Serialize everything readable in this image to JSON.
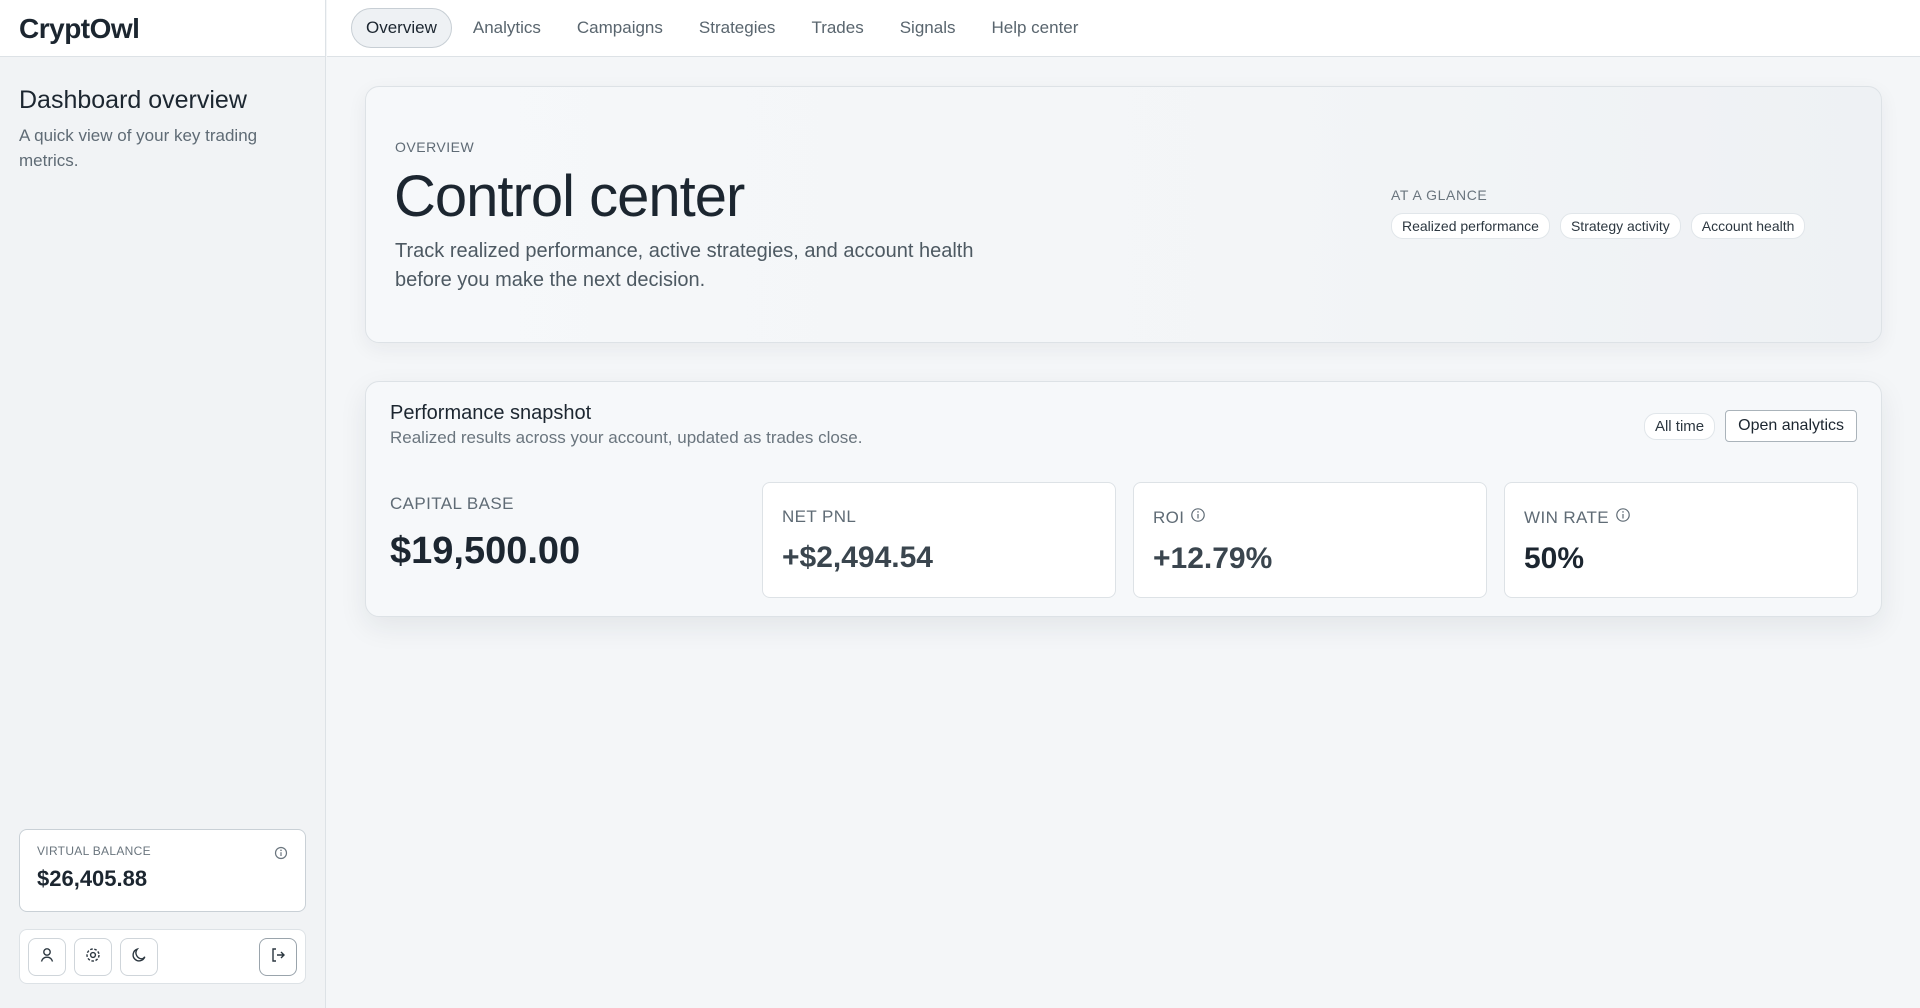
{
  "app": {
    "brand": "CryptOwl"
  },
  "sidebar": {
    "title": "Dashboard overview",
    "subtitle": "A quick view of your key trading metrics.",
    "balance": {
      "label": "VIRTUAL BALANCE",
      "value": "$26,405.88"
    },
    "icons": [
      "user-icon",
      "gear-icon",
      "moon-icon",
      "logout-icon"
    ]
  },
  "nav": {
    "tabs": [
      {
        "label": "Overview"
      },
      {
        "label": "Analytics"
      },
      {
        "label": "Campaigns"
      },
      {
        "label": "Strategies"
      },
      {
        "label": "Trades"
      },
      {
        "label": "Signals"
      },
      {
        "label": "Help center"
      }
    ]
  },
  "hero": {
    "eyebrow": "OVERVIEW",
    "title": "Control center",
    "description": "Track realized performance, active strategies, and account health before you make the next decision.",
    "glance": {
      "label": "AT A GLANCE",
      "pills": [
        "Realized performance",
        "Strategy activity",
        "Account health"
      ]
    }
  },
  "performance": {
    "title": "Performance snapshot",
    "subtitle": "Realized results across your account, updated as trades close.",
    "range_chip": "All time",
    "open_button": "Open analytics",
    "capital": {
      "label": "CAPITAL BASE",
      "value": "$19,500.00"
    },
    "metrics": [
      {
        "label": "NET PNL",
        "value": "+$2,494.54"
      },
      {
        "label": "ROI",
        "value": "+12.79%"
      },
      {
        "label": "WIN RATE",
        "value": "50%"
      }
    ]
  }
}
